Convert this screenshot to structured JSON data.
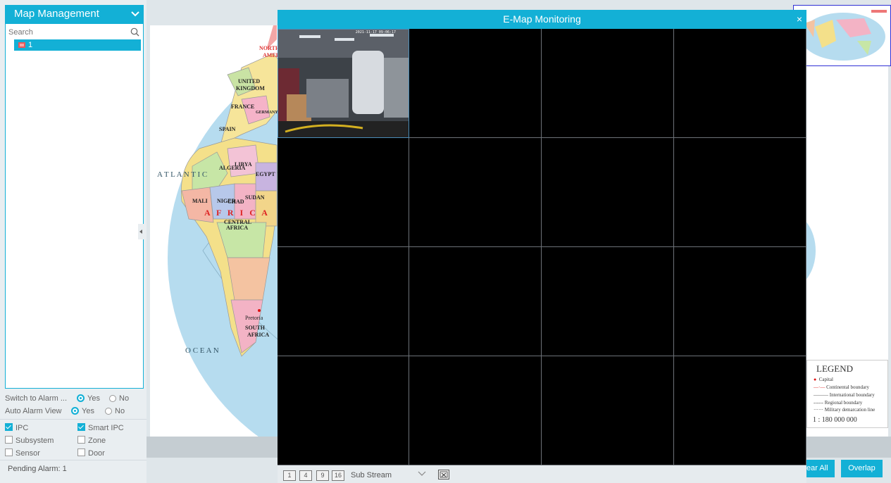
{
  "panel": {
    "title": "Map Management",
    "search_placeholder": "Search",
    "tree_item": "1"
  },
  "options": {
    "switch_label": "Switch to Alarm ...",
    "auto_label": "Auto Alarm View",
    "yes": "Yes",
    "no": "No"
  },
  "filters": {
    "ipc": "IPC",
    "smart_ipc": "Smart IPC",
    "subsystem": "Subsystem",
    "zone": "Zone",
    "sensor": "Sensor",
    "door": "Door"
  },
  "pending": "Pending Alarm: 1",
  "modal": {
    "title": "E-Map Monitoring",
    "close": "×",
    "camera_osd": "2021-11-17 09:06:17",
    "layouts": [
      "1",
      "4",
      "9",
      "16"
    ],
    "stream": "Sub Stream"
  },
  "map": {
    "labels": [
      "NORTH",
      "AMERICA",
      "UNITED",
      "KINGDOM",
      "FRANCE",
      "GERMANY",
      "SPAIN",
      "ALGERIA",
      "LIBYA",
      "EGYPT",
      "MALI",
      "NIGER",
      "CHAD",
      "SUDAN",
      "A F R I C A",
      "CENTRAL",
      "AFRICA",
      "Pretoria",
      "SOUTH",
      "AFRICA",
      "A T L A N T I C",
      "O C E A N"
    ],
    "legend_title": "LEGEND",
    "legend_items": [
      "Capital",
      "Continental boundary",
      "International boundary",
      "Regional boundary",
      "Military demarcation line"
    ],
    "scale": "1 : 180 000 000"
  },
  "buttons": {
    "clear_all": "ear All",
    "overlap": "Overlap"
  },
  "colors": {
    "accent": "#13b0d6",
    "ocean": "#b6dcef"
  }
}
